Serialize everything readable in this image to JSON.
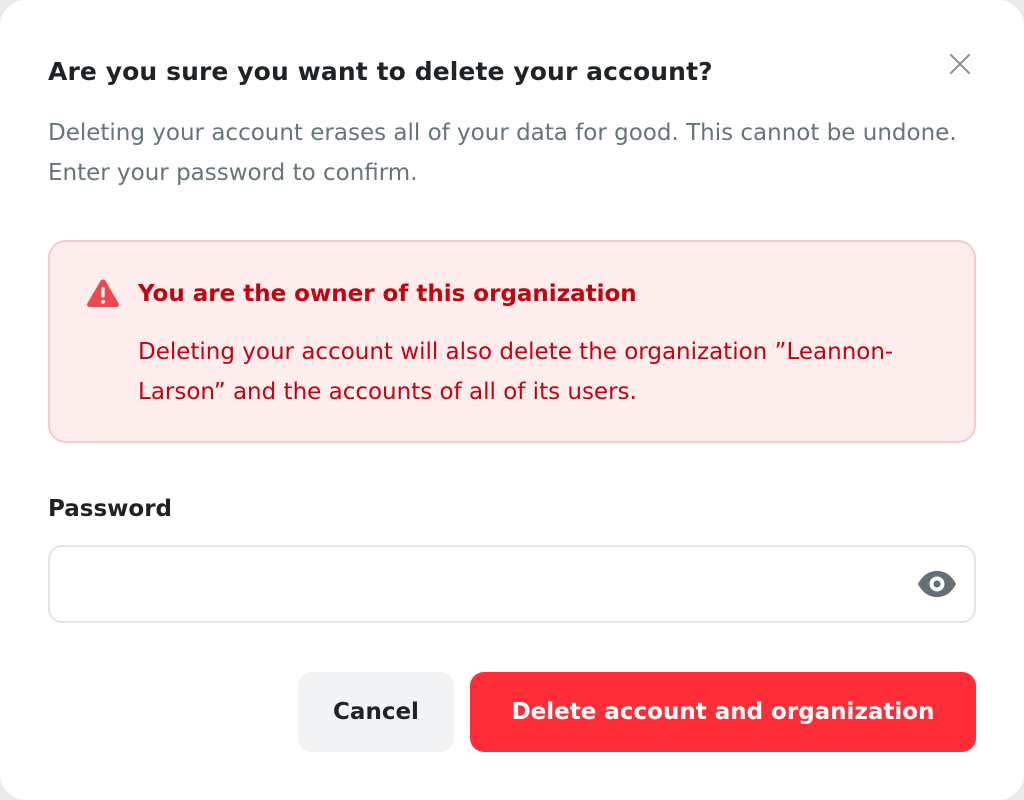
{
  "dialog": {
    "title": "Are you sure you want to delete your account?",
    "description": "Deleting your account erases all of your data for good. This cannot be undone. Enter your password to confirm.",
    "close_icon": "close-icon"
  },
  "alert": {
    "icon": "warning-icon",
    "title": "You are the owner of this organization",
    "body": "Deleting your account will also delete the organization ”Leannon-Larson” and the accounts of all of its users.",
    "text_color": "#c5000f",
    "background_color": "#fdeeed"
  },
  "password": {
    "label": "Password",
    "value": "",
    "placeholder": "",
    "toggle_icon": "eye-icon"
  },
  "actions": {
    "cancel_label": "Cancel",
    "delete_label": "Delete account and organization",
    "delete_color": "#fe2d38"
  }
}
